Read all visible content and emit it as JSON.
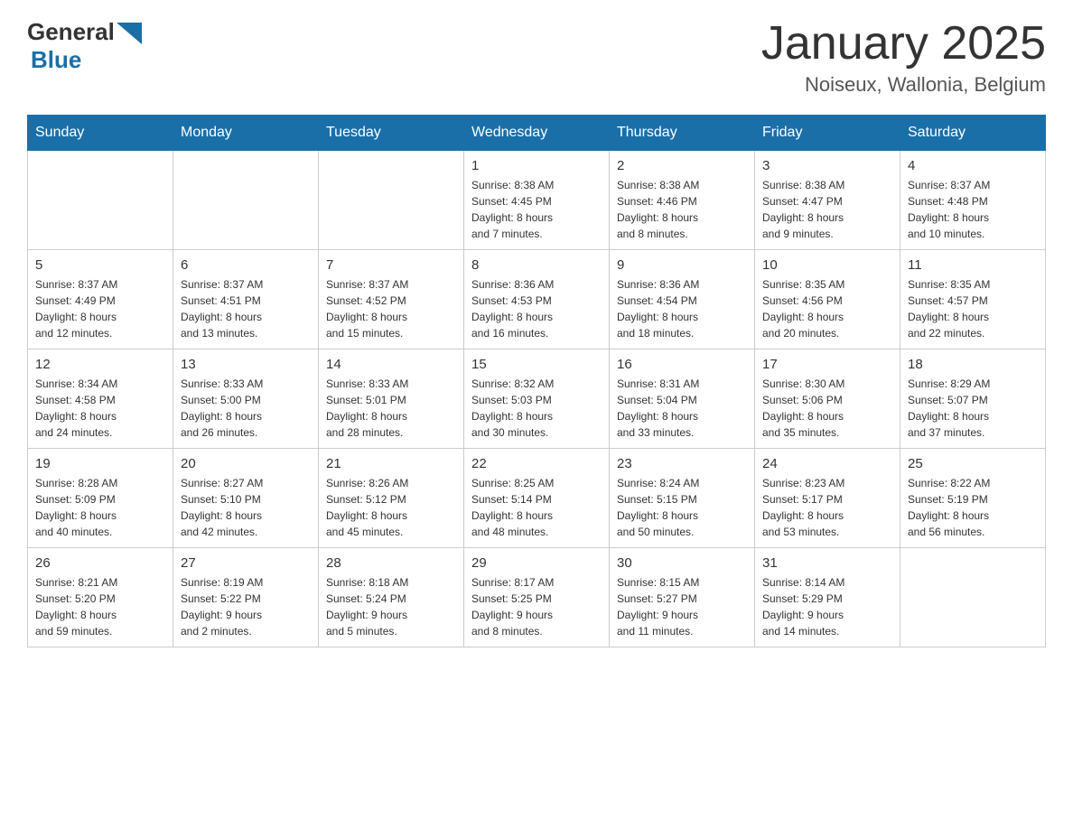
{
  "header": {
    "logo_general": "General",
    "logo_blue": "Blue",
    "month_title": "January 2025",
    "location": "Noiseux, Wallonia, Belgium"
  },
  "days_of_week": [
    "Sunday",
    "Monday",
    "Tuesday",
    "Wednesday",
    "Thursday",
    "Friday",
    "Saturday"
  ],
  "weeks": [
    {
      "days": [
        {
          "number": "",
          "info": ""
        },
        {
          "number": "",
          "info": ""
        },
        {
          "number": "",
          "info": ""
        },
        {
          "number": "1",
          "info": "Sunrise: 8:38 AM\nSunset: 4:45 PM\nDaylight: 8 hours\nand 7 minutes."
        },
        {
          "number": "2",
          "info": "Sunrise: 8:38 AM\nSunset: 4:46 PM\nDaylight: 8 hours\nand 8 minutes."
        },
        {
          "number": "3",
          "info": "Sunrise: 8:38 AM\nSunset: 4:47 PM\nDaylight: 8 hours\nand 9 minutes."
        },
        {
          "number": "4",
          "info": "Sunrise: 8:37 AM\nSunset: 4:48 PM\nDaylight: 8 hours\nand 10 minutes."
        }
      ]
    },
    {
      "days": [
        {
          "number": "5",
          "info": "Sunrise: 8:37 AM\nSunset: 4:49 PM\nDaylight: 8 hours\nand 12 minutes."
        },
        {
          "number": "6",
          "info": "Sunrise: 8:37 AM\nSunset: 4:51 PM\nDaylight: 8 hours\nand 13 minutes."
        },
        {
          "number": "7",
          "info": "Sunrise: 8:37 AM\nSunset: 4:52 PM\nDaylight: 8 hours\nand 15 minutes."
        },
        {
          "number": "8",
          "info": "Sunrise: 8:36 AM\nSunset: 4:53 PM\nDaylight: 8 hours\nand 16 minutes."
        },
        {
          "number": "9",
          "info": "Sunrise: 8:36 AM\nSunset: 4:54 PM\nDaylight: 8 hours\nand 18 minutes."
        },
        {
          "number": "10",
          "info": "Sunrise: 8:35 AM\nSunset: 4:56 PM\nDaylight: 8 hours\nand 20 minutes."
        },
        {
          "number": "11",
          "info": "Sunrise: 8:35 AM\nSunset: 4:57 PM\nDaylight: 8 hours\nand 22 minutes."
        }
      ]
    },
    {
      "days": [
        {
          "number": "12",
          "info": "Sunrise: 8:34 AM\nSunset: 4:58 PM\nDaylight: 8 hours\nand 24 minutes."
        },
        {
          "number": "13",
          "info": "Sunrise: 8:33 AM\nSunset: 5:00 PM\nDaylight: 8 hours\nand 26 minutes."
        },
        {
          "number": "14",
          "info": "Sunrise: 8:33 AM\nSunset: 5:01 PM\nDaylight: 8 hours\nand 28 minutes."
        },
        {
          "number": "15",
          "info": "Sunrise: 8:32 AM\nSunset: 5:03 PM\nDaylight: 8 hours\nand 30 minutes."
        },
        {
          "number": "16",
          "info": "Sunrise: 8:31 AM\nSunset: 5:04 PM\nDaylight: 8 hours\nand 33 minutes."
        },
        {
          "number": "17",
          "info": "Sunrise: 8:30 AM\nSunset: 5:06 PM\nDaylight: 8 hours\nand 35 minutes."
        },
        {
          "number": "18",
          "info": "Sunrise: 8:29 AM\nSunset: 5:07 PM\nDaylight: 8 hours\nand 37 minutes."
        }
      ]
    },
    {
      "days": [
        {
          "number": "19",
          "info": "Sunrise: 8:28 AM\nSunset: 5:09 PM\nDaylight: 8 hours\nand 40 minutes."
        },
        {
          "number": "20",
          "info": "Sunrise: 8:27 AM\nSunset: 5:10 PM\nDaylight: 8 hours\nand 42 minutes."
        },
        {
          "number": "21",
          "info": "Sunrise: 8:26 AM\nSunset: 5:12 PM\nDaylight: 8 hours\nand 45 minutes."
        },
        {
          "number": "22",
          "info": "Sunrise: 8:25 AM\nSunset: 5:14 PM\nDaylight: 8 hours\nand 48 minutes."
        },
        {
          "number": "23",
          "info": "Sunrise: 8:24 AM\nSunset: 5:15 PM\nDaylight: 8 hours\nand 50 minutes."
        },
        {
          "number": "24",
          "info": "Sunrise: 8:23 AM\nSunset: 5:17 PM\nDaylight: 8 hours\nand 53 minutes."
        },
        {
          "number": "25",
          "info": "Sunrise: 8:22 AM\nSunset: 5:19 PM\nDaylight: 8 hours\nand 56 minutes."
        }
      ]
    },
    {
      "days": [
        {
          "number": "26",
          "info": "Sunrise: 8:21 AM\nSunset: 5:20 PM\nDaylight: 8 hours\nand 59 minutes."
        },
        {
          "number": "27",
          "info": "Sunrise: 8:19 AM\nSunset: 5:22 PM\nDaylight: 9 hours\nand 2 minutes."
        },
        {
          "number": "28",
          "info": "Sunrise: 8:18 AM\nSunset: 5:24 PM\nDaylight: 9 hours\nand 5 minutes."
        },
        {
          "number": "29",
          "info": "Sunrise: 8:17 AM\nSunset: 5:25 PM\nDaylight: 9 hours\nand 8 minutes."
        },
        {
          "number": "30",
          "info": "Sunrise: 8:15 AM\nSunset: 5:27 PM\nDaylight: 9 hours\nand 11 minutes."
        },
        {
          "number": "31",
          "info": "Sunrise: 8:14 AM\nSunset: 5:29 PM\nDaylight: 9 hours\nand 14 minutes."
        },
        {
          "number": "",
          "info": ""
        }
      ]
    }
  ]
}
